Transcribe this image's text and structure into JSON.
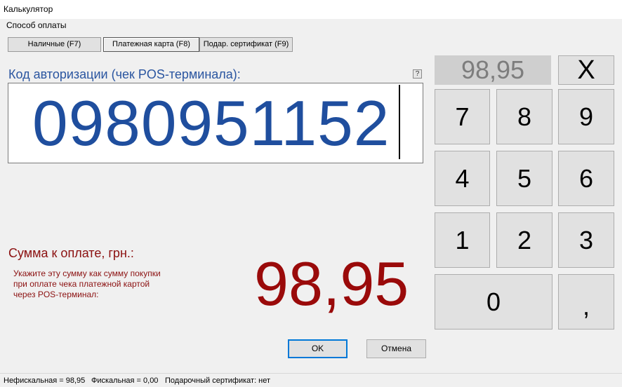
{
  "window": {
    "title": "Калькулятор"
  },
  "payment": {
    "section_label": "Способ оплаты",
    "tabs": [
      {
        "label": "Наличные (F7)"
      },
      {
        "label": "Платежная карта (F8)"
      },
      {
        "label": "Подар. сертификат (F9)"
      }
    ],
    "active_tab": "Платежная карта (F8)"
  },
  "auth": {
    "label": "Код авторизации (чек POS-терминала):",
    "help": "?",
    "value": "0980951152"
  },
  "keypad": {
    "display": "98,95",
    "clear": "X",
    "keys": [
      "7",
      "8",
      "9",
      "4",
      "5",
      "6",
      "1",
      "2",
      "3",
      "0",
      ","
    ]
  },
  "sum": {
    "label": "Сумма к оплате, грн.:",
    "note_lines": [
      "Укажите эту сумму как сумму покупки",
      "при оплате чека платежной картой",
      "через POS-терминал:"
    ],
    "value": "98,95"
  },
  "buttons": {
    "ok": "OK",
    "cancel": "Отмена"
  },
  "status": {
    "nonfiscal": "Нефискальная = 98,95",
    "fiscal": "Фискальная = 0,00",
    "gift": "Подарочный сертификат: нет"
  },
  "colors": {
    "auth_label": "#2a55a0",
    "auth_value": "#1f4e9e",
    "sum_label": "#8b1010",
    "sum_value": "#9a0a0a",
    "display_bg": "#cfcfcf",
    "display_text": "#7d7d7d"
  }
}
